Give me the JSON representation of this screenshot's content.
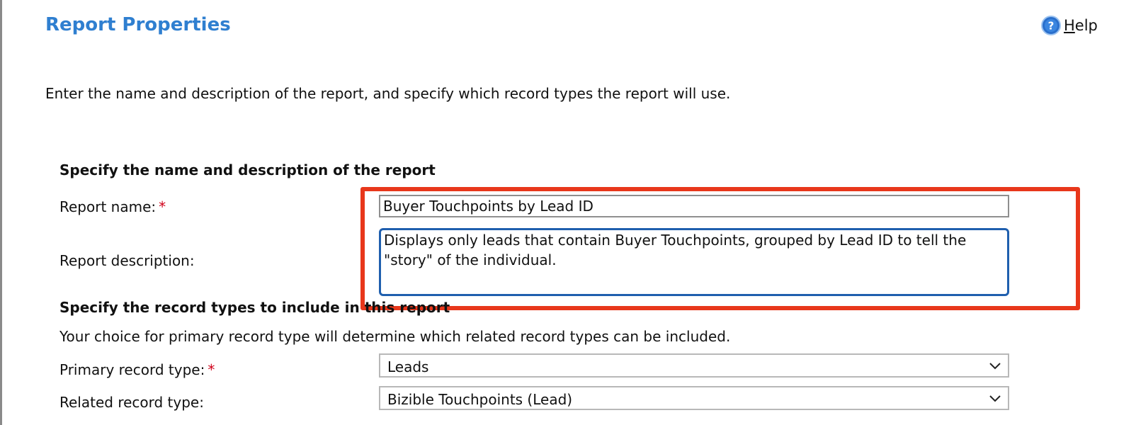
{
  "header": {
    "title": "Report Properties",
    "help": {
      "first_letter": "H",
      "rest": "elp",
      "icon": "help-icon"
    }
  },
  "intro": "Enter the name and description of the report, and specify which record types the report will use.",
  "name_section": {
    "heading": "Specify the name and description of the report",
    "report_name_label": "Report name:",
    "required_marker": "*",
    "report_name_value": "Buyer Touchpoints by Lead ID",
    "description_label": "Report description:",
    "description_value": "Displays only leads that contain Buyer Touchpoints, grouped by Lead ID to tell the \"story\" of the individual. "
  },
  "record_section": {
    "heading": "Specify the record types to include in this report",
    "help_text": "Your choice for primary record type will determine which related record types can be included.",
    "primary_label": "Primary record type:",
    "required_marker": "*",
    "primary_value": "Leads",
    "related_label": "Related record type:",
    "related_value": "Bizible Touchpoints (Lead)"
  },
  "colors": {
    "title": "#2f7fd0",
    "highlight": "#e8371b",
    "focus_border": "#1f5fae",
    "required": "#d0021b"
  }
}
